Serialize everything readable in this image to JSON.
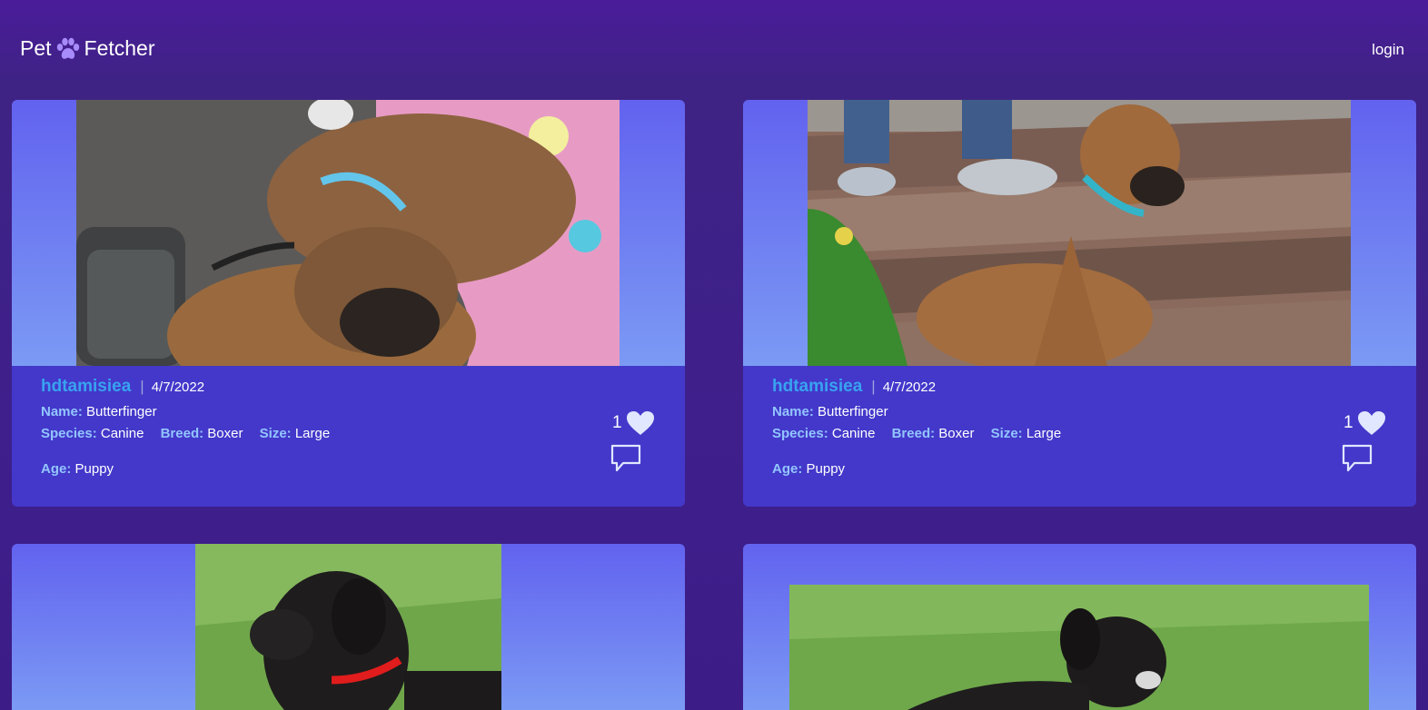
{
  "navbar": {
    "brand_left": "Pet",
    "brand_icon": "paw-icon",
    "brand_right": "Fetcher",
    "login_label": "login"
  },
  "labels": {
    "name": "Name:",
    "species": "Species:",
    "breed": "Breed:",
    "size": "Size:",
    "age": "Age:",
    "separator": "|"
  },
  "posts": [
    {
      "user": "hdtamisiea",
      "date": "4/7/2022",
      "name": "Butterfinger",
      "species": "Canine",
      "breed": "Boxer",
      "size": "Large",
      "age": "Puppy",
      "likes": "1",
      "photo": "two boxer puppies sleeping on blanket"
    },
    {
      "user": "hdtamisiea",
      "date": "4/7/2022",
      "name": "Butterfinger",
      "species": "Canine",
      "breed": "Boxer",
      "size": "Large",
      "age": "Puppy",
      "likes": "1",
      "photo": "boxer puppy sitting on deck"
    },
    {
      "photo": "black puppy with red collar on grass"
    },
    {
      "photo": "black puppy lying on grass"
    }
  ],
  "colors": {
    "background": "#3f1f8c",
    "card_info": "#4338ca",
    "username": "#38a3f0",
    "label": "#93c5fd"
  }
}
